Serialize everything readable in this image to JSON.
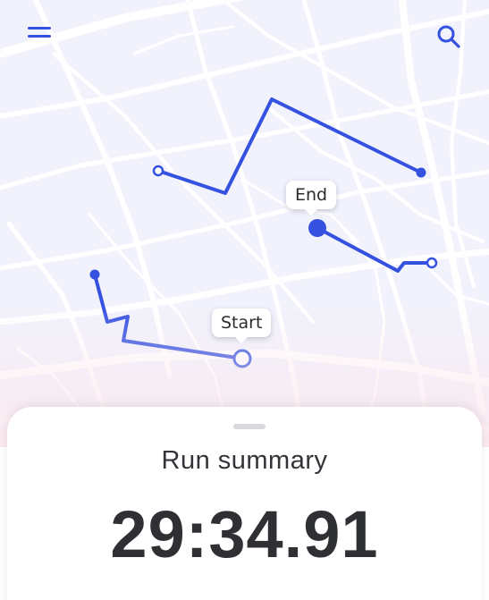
{
  "header": {
    "menu_icon": "hamburger-menu-icon",
    "search_icon": "search-icon"
  },
  "map": {
    "route_color": "#3451e0",
    "street_color": "#ffffff",
    "background_color": "#f1f2fc",
    "labels": {
      "start": "Start",
      "end": "End"
    }
  },
  "summary": {
    "title": "Run summary",
    "time": "29:34.91"
  }
}
